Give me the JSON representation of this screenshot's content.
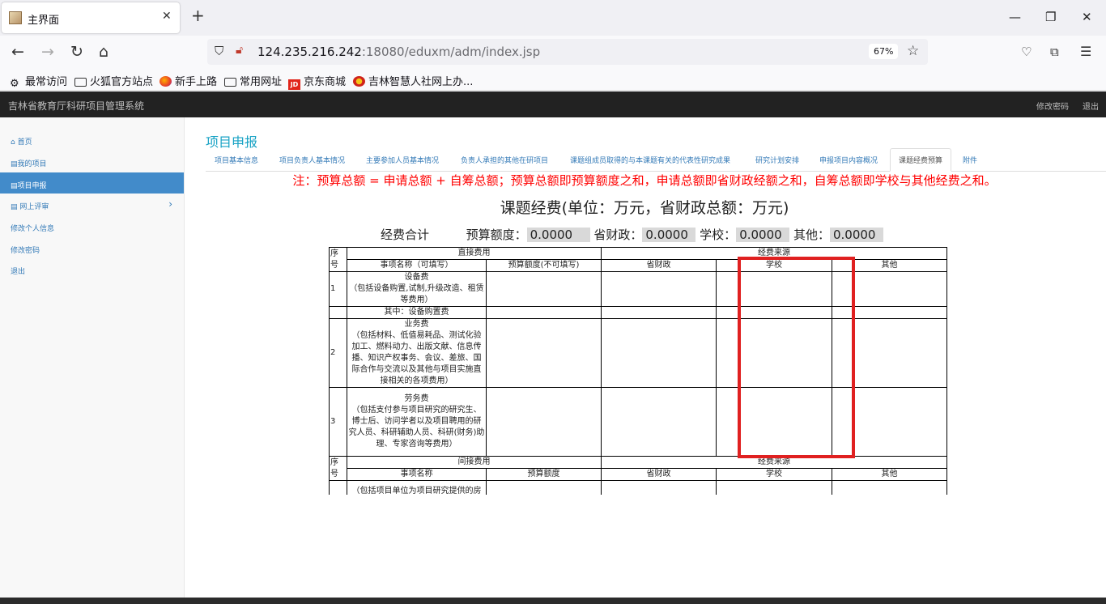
{
  "browser": {
    "tab_title": "主界面",
    "tab_close": "✕",
    "new_tab": "+",
    "url_host": "124.235.216.242",
    "url_path": ":18080/eduxm/adm/index.jsp",
    "zoom": "67%",
    "bookmarks": [
      {
        "label": "最常访问",
        "icon": "gear-icon"
      },
      {
        "label": "火狐官方站点",
        "icon": "folder-icon"
      },
      {
        "label": "新手上路",
        "icon": "firefox-icon"
      },
      {
        "label": "常用网址",
        "icon": "folder-icon"
      },
      {
        "label": "京东商城",
        "icon": "jd-icon"
      },
      {
        "label": "吉林智慧人社网上办...",
        "icon": "emblem-icon"
      }
    ]
  },
  "app": {
    "title": "吉林省教育厅科研项目管理系统",
    "change_password": "修改密码",
    "logout": "退出"
  },
  "sidebar": {
    "items": [
      {
        "label": "首页",
        "icon": "home-icon"
      },
      {
        "label": "我的项目",
        "icon": "list-icon"
      },
      {
        "label": "项目申报",
        "icon": "list-icon",
        "active": true
      },
      {
        "label": "网上评审",
        "icon": "list-icon",
        "chevron": "›"
      },
      {
        "label": "修改个人信息"
      },
      {
        "label": "修改密码"
      },
      {
        "label": "退出"
      }
    ]
  },
  "main": {
    "page_title": "项目申报",
    "tabs": [
      "项目基本信息",
      "项目负责人基本情况",
      "主要参加人员基本情况",
      "负责人承担的其他在研项目",
      "课题组成员取得的与本课题有关的代表性研究成果",
      "研究计划安排",
      "申报项目内容概况",
      "课题经费预算",
      "附件"
    ],
    "active_tab": "课题经费预算",
    "note": "注：预算总额 = 申请总额 + 自筹总额；预算总额即预算额度之和，申请总额即省财政经额之和，自筹总额即学校与其他经费之和。",
    "budget_title": "课题经费(单位：万元，省财政总额：万元)",
    "summary": {
      "label": "经费合计",
      "budget_label": "预算额度：",
      "budget_value": "0.0000",
      "province_label": "省财政：",
      "province_value": "0.0000",
      "school_label": "学校：",
      "school_value": "0.0000",
      "other_label": "其他：",
      "other_value": "0.0000"
    },
    "table": {
      "seq_header": "序号",
      "direct_header": "直接费用",
      "source_header": "经费来源",
      "col_item": "事项名称（可填写）",
      "col_budget": "预算额度(不可填写)",
      "col_province": "省财政",
      "col_school": "学校",
      "col_other": "其他",
      "rows": [
        {
          "seq": "1",
          "item": "设备费\n（包括设备购置,试制,升级改造、租赁等费用）"
        },
        {
          "seq": "",
          "item": "其中：设备购置费"
        },
        {
          "seq": "2",
          "item": "业务费\n（包括材料、低值易耗品、测试化验加工、燃料动力、出版文献、信息传播、知识产权事务、会议、差旅、国际合作与交流以及其他与项目实施直接相关的各项费用）"
        },
        {
          "seq": "3",
          "item": "劳务费\n（包括支付参与项目研究的研究生、博士后、访问学者以及项目聘用的研究人员、科研辅助人员、科研(财务)助理、专家咨询等费用）"
        }
      ],
      "indirect_header": "间接费用",
      "indirect_source_header": "经费来源",
      "col2_item": "事项名称",
      "col2_budget": "预算额度",
      "col2_province": "省财政",
      "col2_school": "学校",
      "col2_other": "其他",
      "indirect_row_item": "（包括项目单位为项目研究提供的房屋占用、日常水、电、气、暖消耗"
    }
  },
  "colors": {
    "accent": "#428bca",
    "title": "#17a2c4",
    "note": "#ff0000",
    "highlight": "#e02020"
  }
}
